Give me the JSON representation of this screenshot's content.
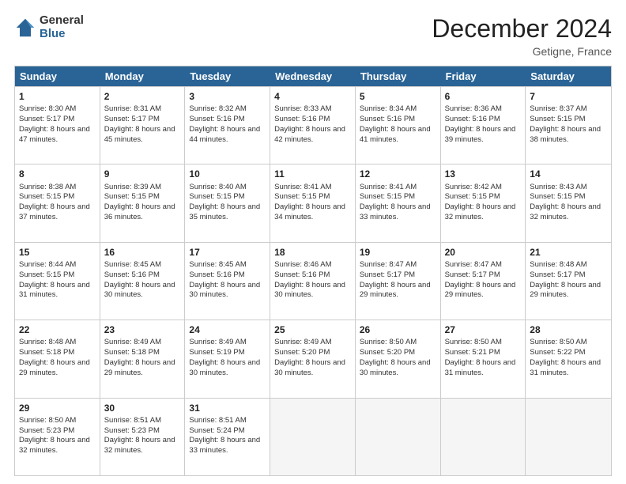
{
  "logo": {
    "general": "General",
    "blue": "Blue"
  },
  "title": "December 2024",
  "location": "Getigne, France",
  "days": [
    "Sunday",
    "Monday",
    "Tuesday",
    "Wednesday",
    "Thursday",
    "Friday",
    "Saturday"
  ],
  "weeks": [
    [
      {
        "day": 1,
        "sunrise": "8:30 AM",
        "sunset": "5:17 PM",
        "daylight": "8 hours and 47 minutes."
      },
      {
        "day": 2,
        "sunrise": "8:31 AM",
        "sunset": "5:17 PM",
        "daylight": "8 hours and 45 minutes."
      },
      {
        "day": 3,
        "sunrise": "8:32 AM",
        "sunset": "5:16 PM",
        "daylight": "8 hours and 44 minutes."
      },
      {
        "day": 4,
        "sunrise": "8:33 AM",
        "sunset": "5:16 PM",
        "daylight": "8 hours and 42 minutes."
      },
      {
        "day": 5,
        "sunrise": "8:34 AM",
        "sunset": "5:16 PM",
        "daylight": "8 hours and 41 minutes."
      },
      {
        "day": 6,
        "sunrise": "8:36 AM",
        "sunset": "5:16 PM",
        "daylight": "8 hours and 39 minutes."
      },
      {
        "day": 7,
        "sunrise": "8:37 AM",
        "sunset": "5:15 PM",
        "daylight": "8 hours and 38 minutes."
      }
    ],
    [
      {
        "day": 8,
        "sunrise": "8:38 AM",
        "sunset": "5:15 PM",
        "daylight": "8 hours and 37 minutes."
      },
      {
        "day": 9,
        "sunrise": "8:39 AM",
        "sunset": "5:15 PM",
        "daylight": "8 hours and 36 minutes."
      },
      {
        "day": 10,
        "sunrise": "8:40 AM",
        "sunset": "5:15 PM",
        "daylight": "8 hours and 35 minutes."
      },
      {
        "day": 11,
        "sunrise": "8:41 AM",
        "sunset": "5:15 PM",
        "daylight": "8 hours and 34 minutes."
      },
      {
        "day": 12,
        "sunrise": "8:41 AM",
        "sunset": "5:15 PM",
        "daylight": "8 hours and 33 minutes."
      },
      {
        "day": 13,
        "sunrise": "8:42 AM",
        "sunset": "5:15 PM",
        "daylight": "8 hours and 32 minutes."
      },
      {
        "day": 14,
        "sunrise": "8:43 AM",
        "sunset": "5:15 PM",
        "daylight": "8 hours and 32 minutes."
      }
    ],
    [
      {
        "day": 15,
        "sunrise": "8:44 AM",
        "sunset": "5:15 PM",
        "daylight": "8 hours and 31 minutes."
      },
      {
        "day": 16,
        "sunrise": "8:45 AM",
        "sunset": "5:16 PM",
        "daylight": "8 hours and 30 minutes."
      },
      {
        "day": 17,
        "sunrise": "8:45 AM",
        "sunset": "5:16 PM",
        "daylight": "8 hours and 30 minutes."
      },
      {
        "day": 18,
        "sunrise": "8:46 AM",
        "sunset": "5:16 PM",
        "daylight": "8 hours and 30 minutes."
      },
      {
        "day": 19,
        "sunrise": "8:47 AM",
        "sunset": "5:17 PM",
        "daylight": "8 hours and 29 minutes."
      },
      {
        "day": 20,
        "sunrise": "8:47 AM",
        "sunset": "5:17 PM",
        "daylight": "8 hours and 29 minutes."
      },
      {
        "day": 21,
        "sunrise": "8:48 AM",
        "sunset": "5:17 PM",
        "daylight": "8 hours and 29 minutes."
      }
    ],
    [
      {
        "day": 22,
        "sunrise": "8:48 AM",
        "sunset": "5:18 PM",
        "daylight": "8 hours and 29 minutes."
      },
      {
        "day": 23,
        "sunrise": "8:49 AM",
        "sunset": "5:18 PM",
        "daylight": "8 hours and 29 minutes."
      },
      {
        "day": 24,
        "sunrise": "8:49 AM",
        "sunset": "5:19 PM",
        "daylight": "8 hours and 30 minutes."
      },
      {
        "day": 25,
        "sunrise": "8:49 AM",
        "sunset": "5:20 PM",
        "daylight": "8 hours and 30 minutes."
      },
      {
        "day": 26,
        "sunrise": "8:50 AM",
        "sunset": "5:20 PM",
        "daylight": "8 hours and 30 minutes."
      },
      {
        "day": 27,
        "sunrise": "8:50 AM",
        "sunset": "5:21 PM",
        "daylight": "8 hours and 31 minutes."
      },
      {
        "day": 28,
        "sunrise": "8:50 AM",
        "sunset": "5:22 PM",
        "daylight": "8 hours and 31 minutes."
      }
    ],
    [
      {
        "day": 29,
        "sunrise": "8:50 AM",
        "sunset": "5:23 PM",
        "daylight": "8 hours and 32 minutes."
      },
      {
        "day": 30,
        "sunrise": "8:51 AM",
        "sunset": "5:23 PM",
        "daylight": "8 hours and 32 minutes."
      },
      {
        "day": 31,
        "sunrise": "8:51 AM",
        "sunset": "5:24 PM",
        "daylight": "8 hours and 33 minutes."
      },
      null,
      null,
      null,
      null
    ]
  ]
}
